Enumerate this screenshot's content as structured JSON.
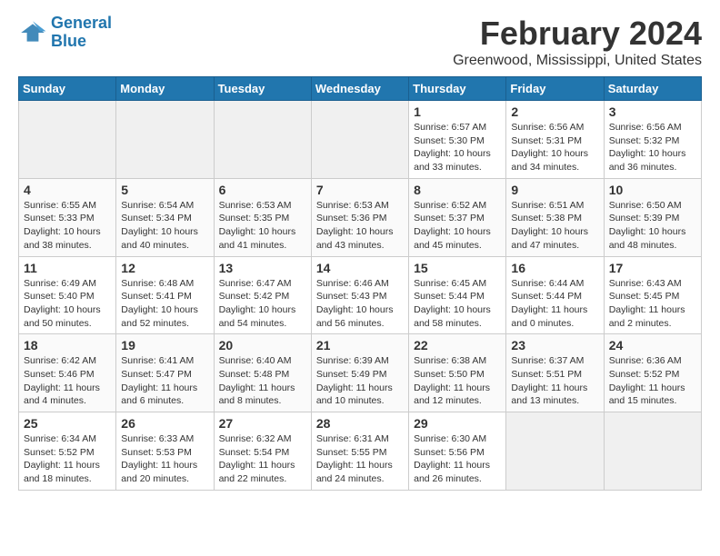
{
  "app": {
    "name_line1": "General",
    "name_line2": "Blue"
  },
  "title": "February 2024",
  "location": "Greenwood, Mississippi, United States",
  "days_of_week": [
    "Sunday",
    "Monday",
    "Tuesday",
    "Wednesday",
    "Thursday",
    "Friday",
    "Saturday"
  ],
  "weeks": [
    [
      {
        "day": "",
        "empty": true
      },
      {
        "day": "",
        "empty": true
      },
      {
        "day": "",
        "empty": true
      },
      {
        "day": "",
        "empty": true
      },
      {
        "day": "1",
        "sunrise": "Sunrise: 6:57 AM",
        "sunset": "Sunset: 5:30 PM",
        "daylight": "Daylight: 10 hours and 33 minutes."
      },
      {
        "day": "2",
        "sunrise": "Sunrise: 6:56 AM",
        "sunset": "Sunset: 5:31 PM",
        "daylight": "Daylight: 10 hours and 34 minutes."
      },
      {
        "day": "3",
        "sunrise": "Sunrise: 6:56 AM",
        "sunset": "Sunset: 5:32 PM",
        "daylight": "Daylight: 10 hours and 36 minutes."
      }
    ],
    [
      {
        "day": "4",
        "sunrise": "Sunrise: 6:55 AM",
        "sunset": "Sunset: 5:33 PM",
        "daylight": "Daylight: 10 hours and 38 minutes."
      },
      {
        "day": "5",
        "sunrise": "Sunrise: 6:54 AM",
        "sunset": "Sunset: 5:34 PM",
        "daylight": "Daylight: 10 hours and 40 minutes."
      },
      {
        "day": "6",
        "sunrise": "Sunrise: 6:53 AM",
        "sunset": "Sunset: 5:35 PM",
        "daylight": "Daylight: 10 hours and 41 minutes."
      },
      {
        "day": "7",
        "sunrise": "Sunrise: 6:53 AM",
        "sunset": "Sunset: 5:36 PM",
        "daylight": "Daylight: 10 hours and 43 minutes."
      },
      {
        "day": "8",
        "sunrise": "Sunrise: 6:52 AM",
        "sunset": "Sunset: 5:37 PM",
        "daylight": "Daylight: 10 hours and 45 minutes."
      },
      {
        "day": "9",
        "sunrise": "Sunrise: 6:51 AM",
        "sunset": "Sunset: 5:38 PM",
        "daylight": "Daylight: 10 hours and 47 minutes."
      },
      {
        "day": "10",
        "sunrise": "Sunrise: 6:50 AM",
        "sunset": "Sunset: 5:39 PM",
        "daylight": "Daylight: 10 hours and 48 minutes."
      }
    ],
    [
      {
        "day": "11",
        "sunrise": "Sunrise: 6:49 AM",
        "sunset": "Sunset: 5:40 PM",
        "daylight": "Daylight: 10 hours and 50 minutes."
      },
      {
        "day": "12",
        "sunrise": "Sunrise: 6:48 AM",
        "sunset": "Sunset: 5:41 PM",
        "daylight": "Daylight: 10 hours and 52 minutes."
      },
      {
        "day": "13",
        "sunrise": "Sunrise: 6:47 AM",
        "sunset": "Sunset: 5:42 PM",
        "daylight": "Daylight: 10 hours and 54 minutes."
      },
      {
        "day": "14",
        "sunrise": "Sunrise: 6:46 AM",
        "sunset": "Sunset: 5:43 PM",
        "daylight": "Daylight: 10 hours and 56 minutes."
      },
      {
        "day": "15",
        "sunrise": "Sunrise: 6:45 AM",
        "sunset": "Sunset: 5:44 PM",
        "daylight": "Daylight: 10 hours and 58 minutes."
      },
      {
        "day": "16",
        "sunrise": "Sunrise: 6:44 AM",
        "sunset": "Sunset: 5:44 PM",
        "daylight": "Daylight: 11 hours and 0 minutes."
      },
      {
        "day": "17",
        "sunrise": "Sunrise: 6:43 AM",
        "sunset": "Sunset: 5:45 PM",
        "daylight": "Daylight: 11 hours and 2 minutes."
      }
    ],
    [
      {
        "day": "18",
        "sunrise": "Sunrise: 6:42 AM",
        "sunset": "Sunset: 5:46 PM",
        "daylight": "Daylight: 11 hours and 4 minutes."
      },
      {
        "day": "19",
        "sunrise": "Sunrise: 6:41 AM",
        "sunset": "Sunset: 5:47 PM",
        "daylight": "Daylight: 11 hours and 6 minutes."
      },
      {
        "day": "20",
        "sunrise": "Sunrise: 6:40 AM",
        "sunset": "Sunset: 5:48 PM",
        "daylight": "Daylight: 11 hours and 8 minutes."
      },
      {
        "day": "21",
        "sunrise": "Sunrise: 6:39 AM",
        "sunset": "Sunset: 5:49 PM",
        "daylight": "Daylight: 11 hours and 10 minutes."
      },
      {
        "day": "22",
        "sunrise": "Sunrise: 6:38 AM",
        "sunset": "Sunset: 5:50 PM",
        "daylight": "Daylight: 11 hours and 12 minutes."
      },
      {
        "day": "23",
        "sunrise": "Sunrise: 6:37 AM",
        "sunset": "Sunset: 5:51 PM",
        "daylight": "Daylight: 11 hours and 13 minutes."
      },
      {
        "day": "24",
        "sunrise": "Sunrise: 6:36 AM",
        "sunset": "Sunset: 5:52 PM",
        "daylight": "Daylight: 11 hours and 15 minutes."
      }
    ],
    [
      {
        "day": "25",
        "sunrise": "Sunrise: 6:34 AM",
        "sunset": "Sunset: 5:52 PM",
        "daylight": "Daylight: 11 hours and 18 minutes."
      },
      {
        "day": "26",
        "sunrise": "Sunrise: 6:33 AM",
        "sunset": "Sunset: 5:53 PM",
        "daylight": "Daylight: 11 hours and 20 minutes."
      },
      {
        "day": "27",
        "sunrise": "Sunrise: 6:32 AM",
        "sunset": "Sunset: 5:54 PM",
        "daylight": "Daylight: 11 hours and 22 minutes."
      },
      {
        "day": "28",
        "sunrise": "Sunrise: 6:31 AM",
        "sunset": "Sunset: 5:55 PM",
        "daylight": "Daylight: 11 hours and 24 minutes."
      },
      {
        "day": "29",
        "sunrise": "Sunrise: 6:30 AM",
        "sunset": "Sunset: 5:56 PM",
        "daylight": "Daylight: 11 hours and 26 minutes."
      },
      {
        "day": "",
        "empty": true
      },
      {
        "day": "",
        "empty": true
      }
    ]
  ]
}
